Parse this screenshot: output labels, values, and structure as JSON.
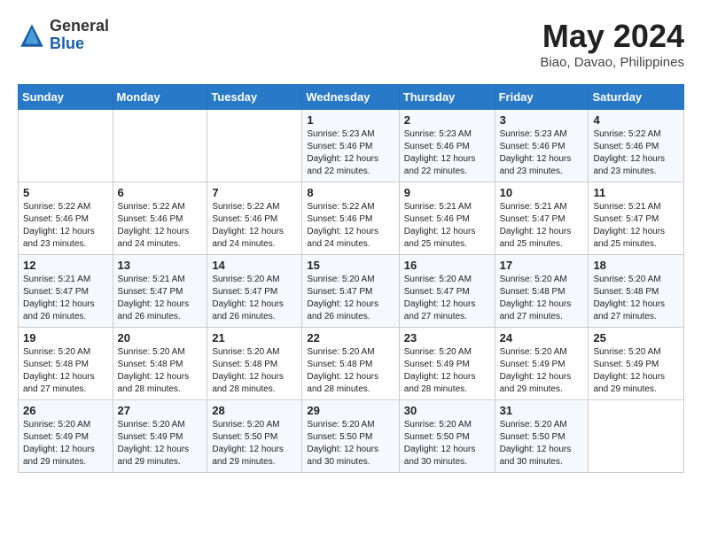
{
  "header": {
    "logo_general": "General",
    "logo_blue": "Blue",
    "month_title": "May 2024",
    "location": "Biao, Davao, Philippines"
  },
  "weekdays": [
    "Sunday",
    "Monday",
    "Tuesday",
    "Wednesday",
    "Thursday",
    "Friday",
    "Saturday"
  ],
  "weeks": [
    [
      {
        "day": "",
        "info": ""
      },
      {
        "day": "",
        "info": ""
      },
      {
        "day": "",
        "info": ""
      },
      {
        "day": "1",
        "info": "Sunrise: 5:23 AM\nSunset: 5:46 PM\nDaylight: 12 hours\nand 22 minutes."
      },
      {
        "day": "2",
        "info": "Sunrise: 5:23 AM\nSunset: 5:46 PM\nDaylight: 12 hours\nand 22 minutes."
      },
      {
        "day": "3",
        "info": "Sunrise: 5:23 AM\nSunset: 5:46 PM\nDaylight: 12 hours\nand 23 minutes."
      },
      {
        "day": "4",
        "info": "Sunrise: 5:22 AM\nSunset: 5:46 PM\nDaylight: 12 hours\nand 23 minutes."
      }
    ],
    [
      {
        "day": "5",
        "info": "Sunrise: 5:22 AM\nSunset: 5:46 PM\nDaylight: 12 hours\nand 23 minutes."
      },
      {
        "day": "6",
        "info": "Sunrise: 5:22 AM\nSunset: 5:46 PM\nDaylight: 12 hours\nand 24 minutes."
      },
      {
        "day": "7",
        "info": "Sunrise: 5:22 AM\nSunset: 5:46 PM\nDaylight: 12 hours\nand 24 minutes."
      },
      {
        "day": "8",
        "info": "Sunrise: 5:22 AM\nSunset: 5:46 PM\nDaylight: 12 hours\nand 24 minutes."
      },
      {
        "day": "9",
        "info": "Sunrise: 5:21 AM\nSunset: 5:46 PM\nDaylight: 12 hours\nand 25 minutes."
      },
      {
        "day": "10",
        "info": "Sunrise: 5:21 AM\nSunset: 5:47 PM\nDaylight: 12 hours\nand 25 minutes."
      },
      {
        "day": "11",
        "info": "Sunrise: 5:21 AM\nSunset: 5:47 PM\nDaylight: 12 hours\nand 25 minutes."
      }
    ],
    [
      {
        "day": "12",
        "info": "Sunrise: 5:21 AM\nSunset: 5:47 PM\nDaylight: 12 hours\nand 26 minutes."
      },
      {
        "day": "13",
        "info": "Sunrise: 5:21 AM\nSunset: 5:47 PM\nDaylight: 12 hours\nand 26 minutes."
      },
      {
        "day": "14",
        "info": "Sunrise: 5:20 AM\nSunset: 5:47 PM\nDaylight: 12 hours\nand 26 minutes."
      },
      {
        "day": "15",
        "info": "Sunrise: 5:20 AM\nSunset: 5:47 PM\nDaylight: 12 hours\nand 26 minutes."
      },
      {
        "day": "16",
        "info": "Sunrise: 5:20 AM\nSunset: 5:47 PM\nDaylight: 12 hours\nand 27 minutes."
      },
      {
        "day": "17",
        "info": "Sunrise: 5:20 AM\nSunset: 5:48 PM\nDaylight: 12 hours\nand 27 minutes."
      },
      {
        "day": "18",
        "info": "Sunrise: 5:20 AM\nSunset: 5:48 PM\nDaylight: 12 hours\nand 27 minutes."
      }
    ],
    [
      {
        "day": "19",
        "info": "Sunrise: 5:20 AM\nSunset: 5:48 PM\nDaylight: 12 hours\nand 27 minutes."
      },
      {
        "day": "20",
        "info": "Sunrise: 5:20 AM\nSunset: 5:48 PM\nDaylight: 12 hours\nand 28 minutes."
      },
      {
        "day": "21",
        "info": "Sunrise: 5:20 AM\nSunset: 5:48 PM\nDaylight: 12 hours\nand 28 minutes."
      },
      {
        "day": "22",
        "info": "Sunrise: 5:20 AM\nSunset: 5:48 PM\nDaylight: 12 hours\nand 28 minutes."
      },
      {
        "day": "23",
        "info": "Sunrise: 5:20 AM\nSunset: 5:49 PM\nDaylight: 12 hours\nand 28 minutes."
      },
      {
        "day": "24",
        "info": "Sunrise: 5:20 AM\nSunset: 5:49 PM\nDaylight: 12 hours\nand 29 minutes."
      },
      {
        "day": "25",
        "info": "Sunrise: 5:20 AM\nSunset: 5:49 PM\nDaylight: 12 hours\nand 29 minutes."
      }
    ],
    [
      {
        "day": "26",
        "info": "Sunrise: 5:20 AM\nSunset: 5:49 PM\nDaylight: 12 hours\nand 29 minutes."
      },
      {
        "day": "27",
        "info": "Sunrise: 5:20 AM\nSunset: 5:49 PM\nDaylight: 12 hours\nand 29 minutes."
      },
      {
        "day": "28",
        "info": "Sunrise: 5:20 AM\nSunset: 5:50 PM\nDaylight: 12 hours\nand 29 minutes."
      },
      {
        "day": "29",
        "info": "Sunrise: 5:20 AM\nSunset: 5:50 PM\nDaylight: 12 hours\nand 30 minutes."
      },
      {
        "day": "30",
        "info": "Sunrise: 5:20 AM\nSunset: 5:50 PM\nDaylight: 12 hours\nand 30 minutes."
      },
      {
        "day": "31",
        "info": "Sunrise: 5:20 AM\nSunset: 5:50 PM\nDaylight: 12 hours\nand 30 minutes."
      },
      {
        "day": "",
        "info": ""
      }
    ]
  ]
}
